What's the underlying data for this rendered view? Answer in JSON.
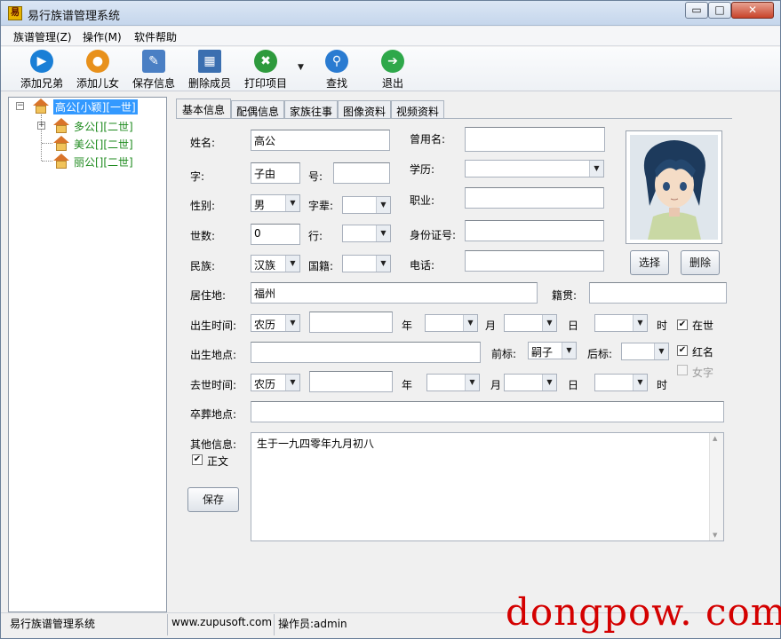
{
  "window": {
    "title": "易行族谱管理系统",
    "controls": {
      "minimize": "▭",
      "maximize": "□",
      "close": "✕"
    }
  },
  "menu": [
    "族谱管理(Z)",
    "操作(M)",
    "软件帮助"
  ],
  "toolbar": {
    "buttons": [
      {
        "label": "添加兄弟",
        "icon": "play-circle-icon",
        "color": "#1a7fd6"
      },
      {
        "label": "添加儿女",
        "icon": "person-icon",
        "color": "#e8911c"
      },
      {
        "label": "保存信息",
        "icon": "pencil-icon",
        "color": "#4a7fc4"
      },
      {
        "label": "删除成员",
        "icon": "grid-icon",
        "color": "#3b6fb0"
      },
      {
        "label": "打印项目",
        "icon": "tools-icon",
        "color": "#2e9a3d"
      },
      {
        "label": "查找",
        "icon": "search-icon",
        "color": "#2a7bd1"
      },
      {
        "label": "退出",
        "icon": "exit-arrow-icon",
        "color": "#2ea84a"
      }
    ],
    "print_dropdown": "▼"
  },
  "tree": {
    "root": "高公[小颖][一世]",
    "children": [
      "多公[][二世]",
      "美公[][二世]",
      "丽公[][二世]"
    ]
  },
  "tabs": [
    "基本信息",
    "配偶信息",
    "家族往事",
    "图像资料",
    "视频资料"
  ],
  "form": {
    "name_label": "姓名:",
    "name_value": "高公",
    "former_name_label": "曾用名:",
    "former_name_value": "",
    "zi_label": "字:",
    "zi_value": "子由",
    "hao_label": "号:",
    "hao_value": "",
    "education_label": "学历:",
    "education_value": "",
    "gender_label": "性别:",
    "gender_value": "男",
    "generation_char_label": "字辈:",
    "generation_char_value": "",
    "occupation_label": "职业:",
    "occupation_value": "",
    "generation_label": "世数:",
    "generation_value": "0",
    "rank_label": "行:",
    "rank_value": "",
    "id_label": "身份证号:",
    "id_value": "",
    "ethnicity_label": "民族:",
    "ethnicity_value": "汉族",
    "nationality_label": "国籍:",
    "nationality_value": "",
    "phone_label": "电话:",
    "phone_value": "",
    "residence_label": "居住地:",
    "residence_value": "福州",
    "hometown_label": "籍贯:",
    "hometown_value": "",
    "birth_time_label": "出生时间:",
    "birth_calendar": "农历",
    "birth_year_value": "",
    "year_label": "年",
    "month_label": "月",
    "day_label": "日",
    "hour_label": "时",
    "alive_label": "在世",
    "alive_checked": "✔",
    "birth_place_label": "出生地点:",
    "birth_place_value": "",
    "prefix_label": "前标:",
    "prefix_value": "嗣子",
    "suffix_label": "后标:",
    "suffix_value": "",
    "red_name_label": "红名",
    "red_name_checked": "✔",
    "female_label": "女字",
    "death_time_label": "去世时间:",
    "death_calendar": "农历",
    "death_year_value": "",
    "burial_place_label": "卒葬地点:",
    "burial_place_value": "",
    "other_info_label": "其他信息:",
    "other_info_value": "生于一九四零年九月初八",
    "main_text_label": "正文",
    "main_text_checked": "✔",
    "save_button": "保存",
    "choose_button": "选择",
    "delete_button": "删除"
  },
  "status": {
    "app": "易行族谱管理系统",
    "website": "www.zupusoft.com",
    "operator": "操作员:admin"
  },
  "watermark": "dongpow. com"
}
